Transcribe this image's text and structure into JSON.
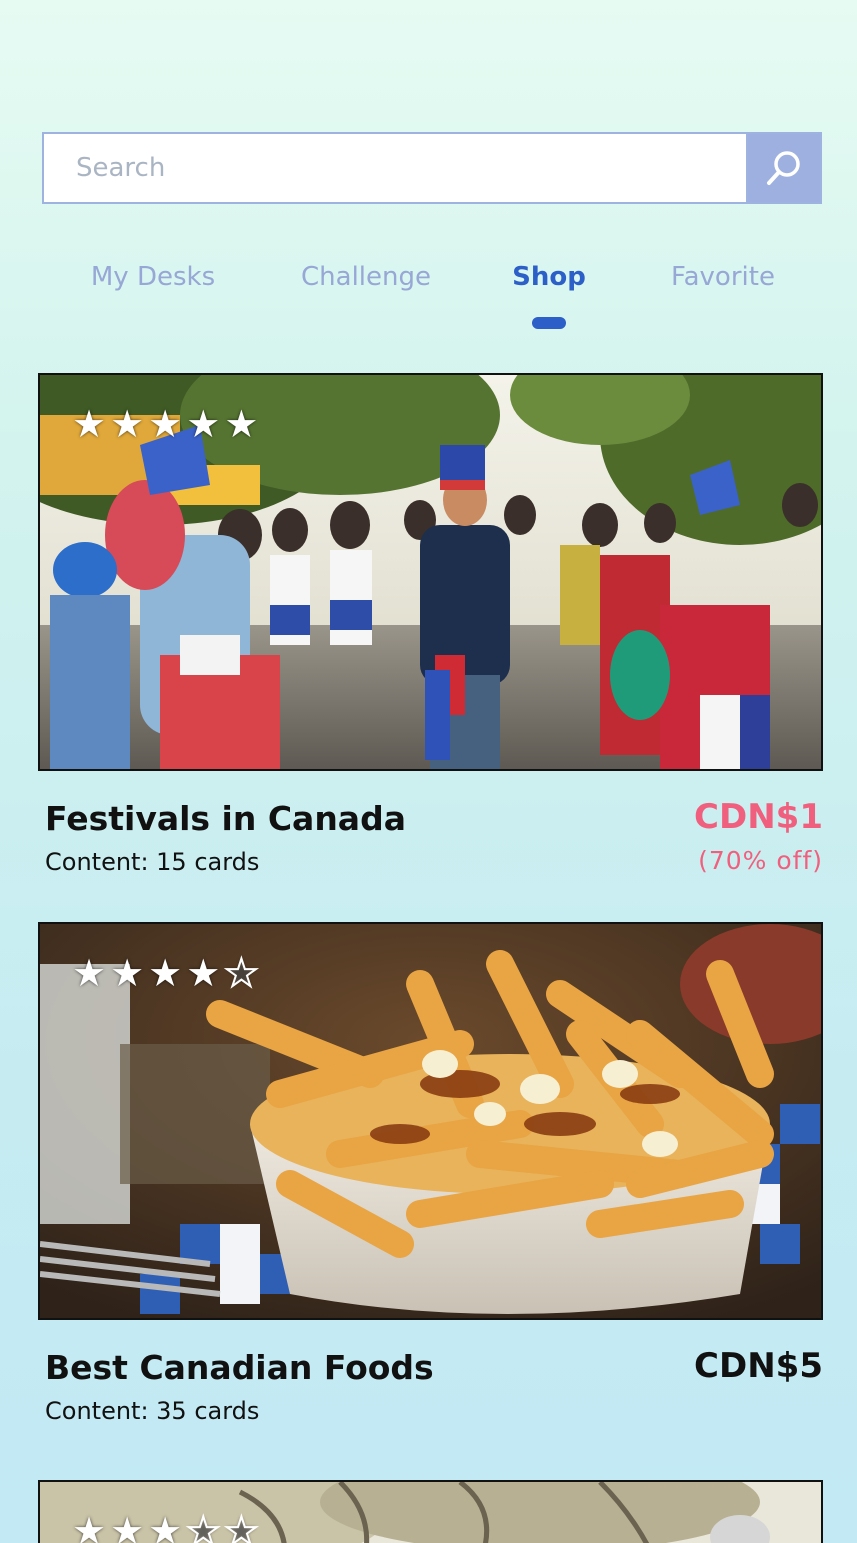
{
  "search": {
    "placeholder": "Search",
    "button_icon": "search-icon"
  },
  "tabs": [
    {
      "label": "My Desks",
      "active": false
    },
    {
      "label": "Challenge",
      "active": false
    },
    {
      "label": "Shop",
      "active": true
    },
    {
      "label": "Favorite",
      "active": false
    }
  ],
  "colors": {
    "accent": "#2c5fc7",
    "tab_inactive": "#97a7d6",
    "sale_price": "#f0607e",
    "search_button": "#9db0df"
  },
  "cards": [
    {
      "title": "Festivals in Canada",
      "content": "Content: 15 cards",
      "price": "CDN$1",
      "discount": "(70% off)",
      "rating": 5,
      "image": "festival-parade-photo"
    },
    {
      "title": "Best Canadian Foods",
      "content": "Content: 35 cards",
      "price": "CDN$5",
      "rating": 4,
      "image": "poutine-photo"
    },
    {
      "rating": 3,
      "image": "outdoor-trees-photo"
    }
  ]
}
